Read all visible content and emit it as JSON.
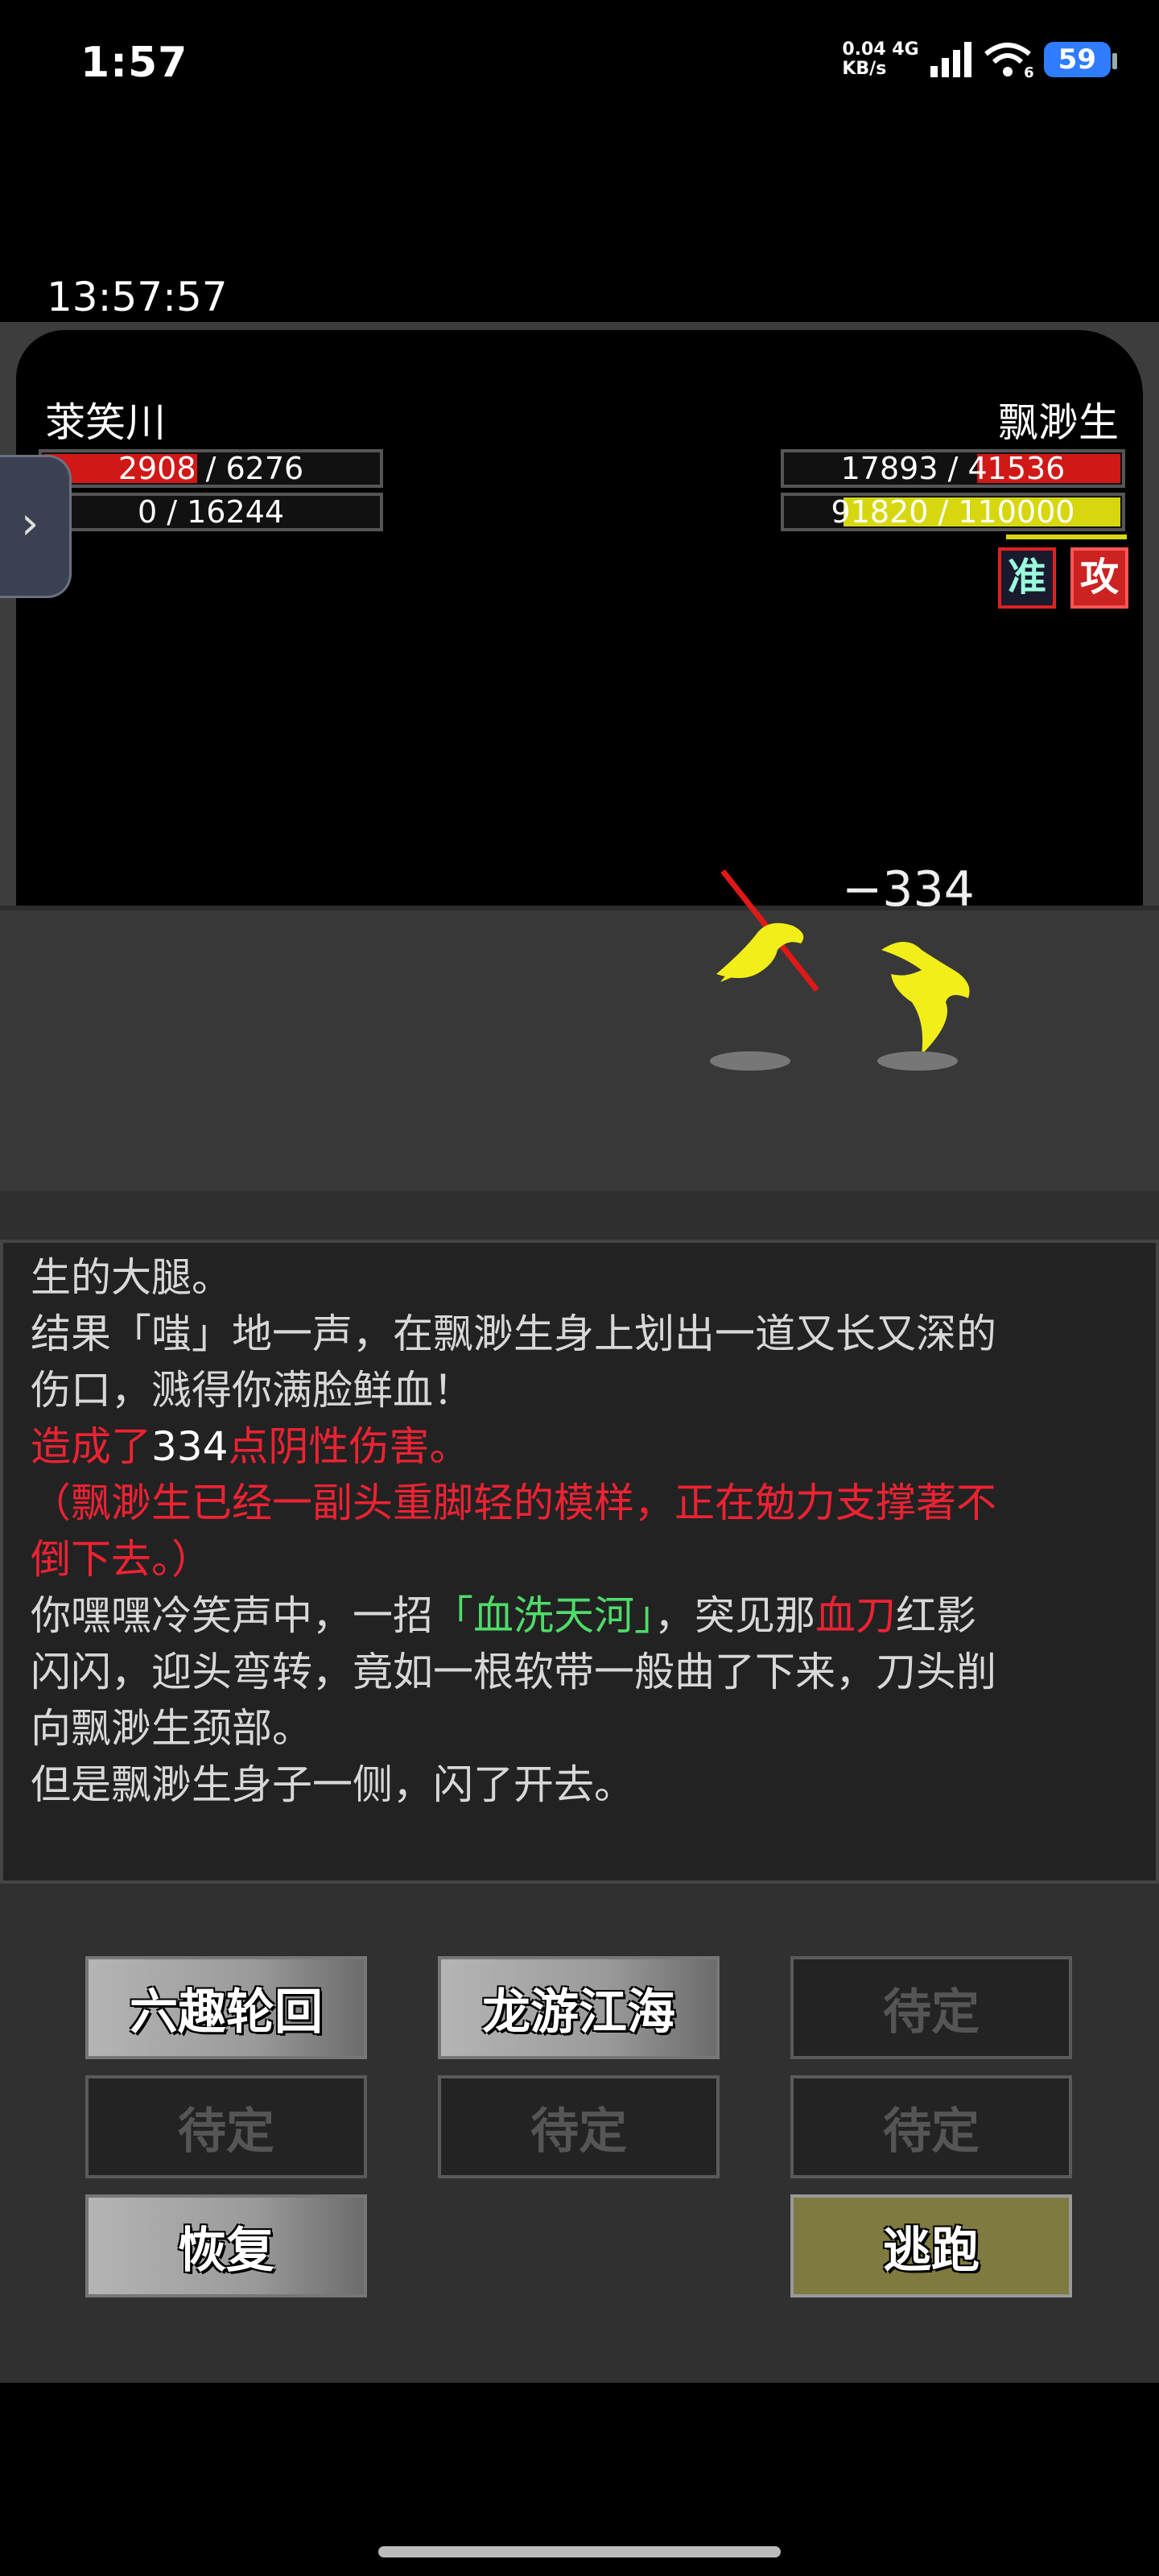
{
  "status_bar": {
    "time": "1:57",
    "net_speed_value": "0.04",
    "net_speed_unit": "KB/s",
    "network": "4G",
    "wifi_badge": "6",
    "battery": "59"
  },
  "game_time": "13:57:57",
  "player": {
    "name": "莍笑川",
    "hp_text": "2908 / 6276",
    "hp_fraction": 0.463,
    "mp_text": "0 / 16244",
    "mp_fraction": 0.0,
    "hp_color": "#d01818"
  },
  "enemy": {
    "name": "飘渺生",
    "hp_text": "17893 / 41536",
    "hp_fraction": 0.431,
    "mp_text": "91820 / 110000",
    "mp_fraction": 0.835,
    "hp_color": "#d01818",
    "mp_color": "#d7d710",
    "status_badges": [
      "准",
      "攻"
    ]
  },
  "damage_popup": "−334",
  "combat_log": [
    [
      {
        "t": "生的大腿。",
        "c": "normal"
      }
    ],
    [
      {
        "t": "结果「嗤」地一声，在飘渺生身上划出一道又长又深的",
        "c": "normal"
      }
    ],
    [
      {
        "t": "伤口，溅得你满脸鲜血！",
        "c": "normal"
      }
    ],
    [
      {
        "t": "造成了",
        "c": "red"
      },
      {
        "t": "334",
        "c": "white"
      },
      {
        "t": "点阴性伤害。",
        "c": "red"
      }
    ],
    [
      {
        "t": "（飘渺生已经一副头重脚轻的模样，正在勉力支撑著不",
        "c": "red"
      }
    ],
    [
      {
        "t": "倒下去。）",
        "c": "red"
      }
    ],
    [
      {
        "t": "你嘿嘿冷笑声中，一招",
        "c": "normal"
      },
      {
        "t": "「血洗天河」",
        "c": "green"
      },
      {
        "t": "，突见那",
        "c": "normal"
      },
      {
        "t": "血刀",
        "c": "red"
      },
      {
        "t": "红影",
        "c": "normal"
      }
    ],
    [
      {
        "t": "闪闪，迎头弯转，竟如一根软带一般曲了下来，刀头削",
        "c": "normal"
      }
    ],
    [
      {
        "t": "向飘渺生颈部。",
        "c": "normal"
      }
    ],
    [
      {
        "t": "但是飘渺生身子一侧，闪了开去。",
        "c": "normal"
      }
    ]
  ],
  "actions": {
    "skill_1": "六趣轮回",
    "skill_2": "龙游江海",
    "skill_3": "待定",
    "skill_4": "待定",
    "skill_5": "待定",
    "skill_6": "待定",
    "recover": "恢复",
    "flee": "逃跑"
  }
}
